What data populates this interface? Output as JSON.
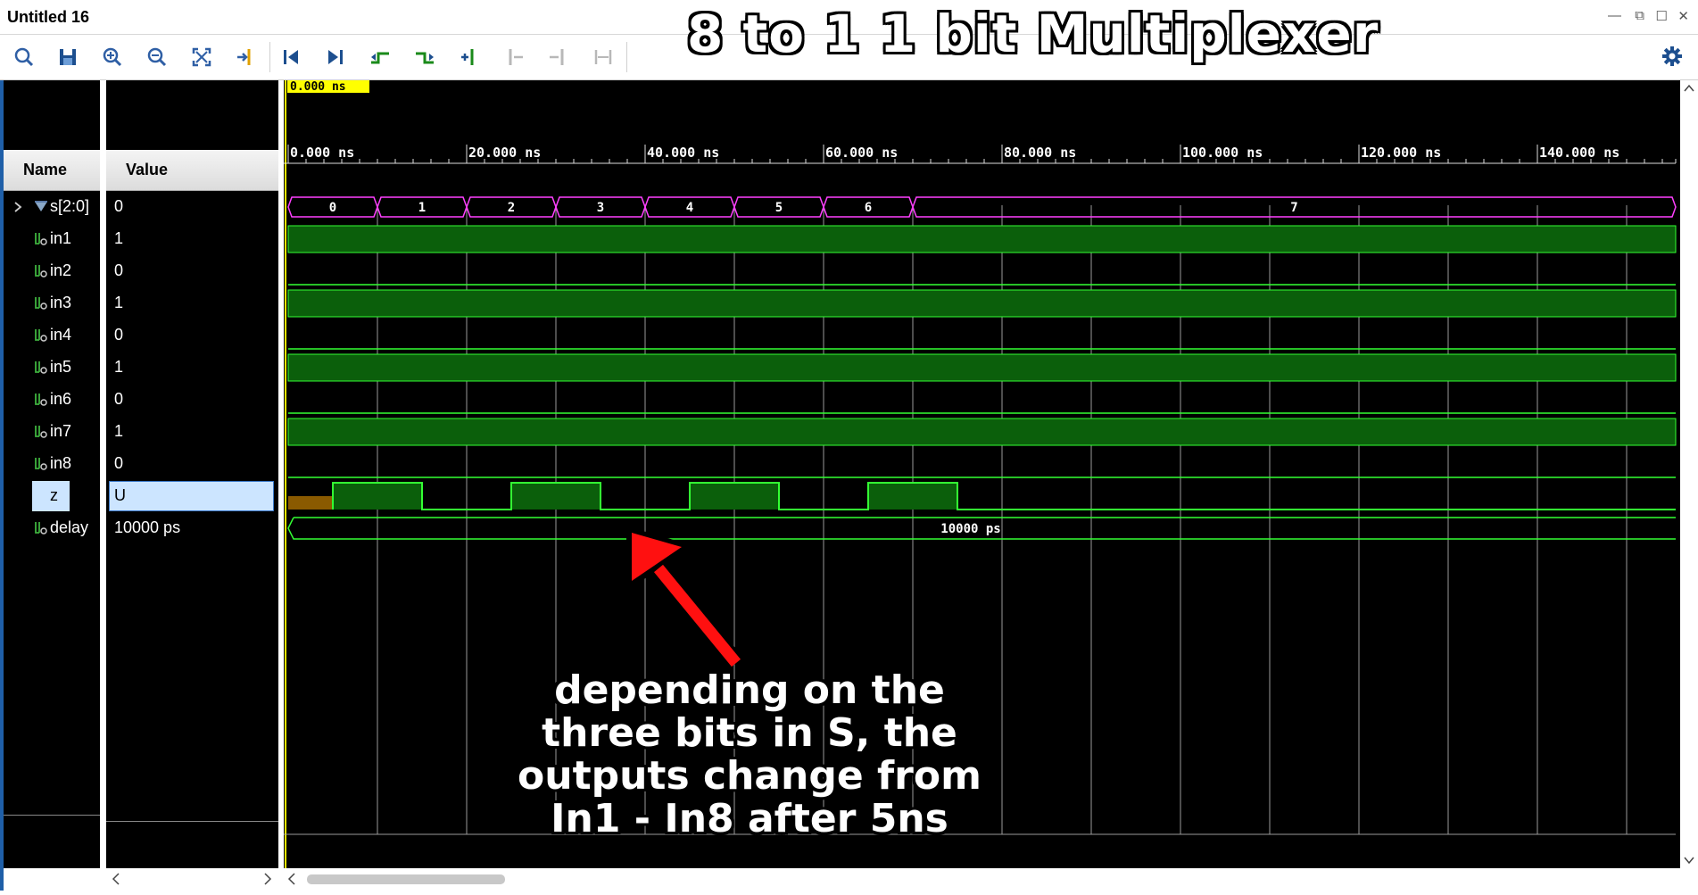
{
  "window": {
    "title": "Untitled 16"
  },
  "overlay_title": "8 to 1   1 bit Multiplexer",
  "toolbar": {
    "icons": [
      "search-icon",
      "save-icon",
      "zoom-in-icon",
      "zoom-out-icon",
      "zoom-fit-icon",
      "go-to-cursor-icon",
      "go-to-start-icon",
      "go-to-end-icon",
      "previous-transition-icon",
      "next-transition-icon",
      "add-marker-icon",
      "previous-marker-icon",
      "next-marker-icon",
      "swap-cursors-icon"
    ],
    "settings_icon": "gear-icon"
  },
  "columns": {
    "name": "Name",
    "value": "Value"
  },
  "signals": [
    {
      "name": "s[2:0]",
      "value": "0",
      "type": "bus"
    },
    {
      "name": "in1",
      "value": "1",
      "type": "bit"
    },
    {
      "name": "in2",
      "value": "0",
      "type": "bit"
    },
    {
      "name": "in3",
      "value": "1",
      "type": "bit"
    },
    {
      "name": "in4",
      "value": "0",
      "type": "bit"
    },
    {
      "name": "in5",
      "value": "1",
      "type": "bit"
    },
    {
      "name": "in6",
      "value": "0",
      "type": "bit"
    },
    {
      "name": "in7",
      "value": "1",
      "type": "bit"
    },
    {
      "name": "in8",
      "value": "0",
      "type": "bit"
    },
    {
      "name": "z",
      "value": "U",
      "type": "bit",
      "selected": true
    },
    {
      "name": "delay",
      "value": "10000 ps",
      "type": "param"
    }
  ],
  "cursor_label": "0.000 ns",
  "time_axis": {
    "unit": "ns",
    "labels": [
      "0.000 ns",
      "20.000 ns",
      "40.000 ns",
      "60.000 ns",
      "80.000 ns",
      "100.000 ns",
      "120.000 ns",
      "140.000 ns"
    ],
    "label_values": [
      0,
      20,
      40,
      60,
      80,
      100,
      120,
      140
    ],
    "major_step": 20,
    "minor_step": 2,
    "grid_step": 10,
    "range": [
      0,
      156
    ]
  },
  "waves": {
    "s_segments": [
      {
        "start": 0,
        "end": 10,
        "label": "0"
      },
      {
        "start": 10,
        "end": 20,
        "label": "1"
      },
      {
        "start": 20,
        "end": 30,
        "label": "2"
      },
      {
        "start": 30,
        "end": 40,
        "label": "3"
      },
      {
        "start": 40,
        "end": 50,
        "label": "4"
      },
      {
        "start": 50,
        "end": 60,
        "label": "5"
      },
      {
        "start": 60,
        "end": 70,
        "label": "6"
      },
      {
        "start": 70,
        "end": 156,
        "label": "7"
      }
    ],
    "z_undefined": [
      0,
      5
    ],
    "z_high": [
      [
        5,
        15
      ],
      [
        25,
        35
      ],
      [
        45,
        55
      ],
      [
        65,
        75
      ]
    ],
    "delay_label": "10000 ps"
  },
  "annotation": [
    "depending on the",
    "three bits in S, the",
    "outputs change from",
    "In1 - In8 after 5ns"
  ],
  "colors": {
    "bus": "#ff40ff",
    "bit_fill": "#0b5f0b",
    "bit_line": "#33ff33",
    "undefined": "#8a5a00",
    "cursor": "#ffff00",
    "grid": "#9a9a9a",
    "arrow": "#ff1010",
    "selection": "#cce5ff"
  }
}
